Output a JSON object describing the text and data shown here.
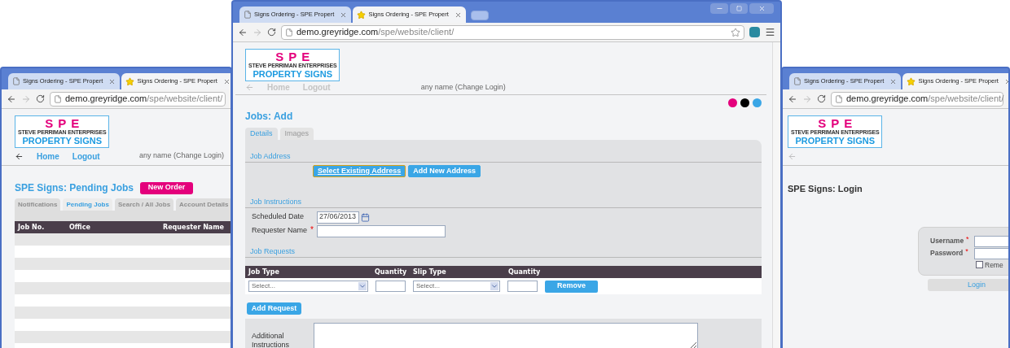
{
  "windows": [
    {
      "kind": "pending_jobs",
      "window_controls": false,
      "browser_tabs": [
        {
          "title": "Signs Ordering - SPE Propert",
          "selected": false
        },
        {
          "title": "Signs Ordering - SPE Propert",
          "selected": true
        }
      ],
      "address": {
        "host": "demo.greyridge.com",
        "path": "/spe/website/client/"
      },
      "logo": {
        "initials": "SPE",
        "tagline": "STEVE PERRIMAN ENTERPRISES",
        "name": "PROPERTY SIGNS"
      },
      "nav": [
        {
          "label": "Home",
          "disabled": false
        },
        {
          "label": "Logout",
          "disabled": false
        }
      ],
      "user": "any name (Change Login)",
      "heading": "SPE Signs: Pending Jobs",
      "new_order_button": "New Order",
      "page_tabs": [
        {
          "label": "Notifications",
          "selected": false
        },
        {
          "label": "Pending Jobs",
          "selected": true
        },
        {
          "label": "Search / All Jobs",
          "selected": false
        },
        {
          "label": "Account Details",
          "selected": false
        }
      ],
      "table": {
        "columns": [
          "Job No.",
          "Office",
          "Requester Name"
        ]
      }
    },
    {
      "kind": "add_job",
      "window_controls": true,
      "browser_tabs": [
        {
          "title": "Signs Ordering - SPE Propert",
          "selected": false
        },
        {
          "title": "Signs Ordering - SPE Propert",
          "selected": true
        }
      ],
      "address": {
        "host": "demo.greyridge.com",
        "path": "/spe/website/client/"
      },
      "logo": {
        "initials": "SPE",
        "tagline": "STEVE PERRIMAN ENTERPRISES",
        "name": "PROPERTY SIGNS"
      },
      "nav": [
        {
          "label": "Home",
          "disabled": true
        },
        {
          "label": "Logout",
          "disabled": true
        }
      ],
      "user": "any name (Change Login)",
      "swatches": [
        {
          "color": "#e4007c"
        },
        {
          "color": "#000000"
        },
        {
          "color": "#3aa6e6"
        }
      ],
      "heading": "Jobs: Add",
      "page_tabs": [
        {
          "label": "Details",
          "selected": true
        },
        {
          "label": "Images",
          "selected": false
        }
      ],
      "sections": [
        {
          "kind": "buttons",
          "title": "Job Address",
          "buttons": [
            {
              "label": "Select Existing Address",
              "focused": true
            },
            {
              "label": "Add New Address",
              "focused": false
            }
          ]
        },
        {
          "kind": "fields",
          "title": "Job Instructions",
          "fields": [
            {
              "kind": "date",
              "label": "Scheduled Date",
              "value": "27/06/2013"
            },
            {
              "kind": "text",
              "label": "Requester Name",
              "marker": "*"
            }
          ]
        },
        {
          "kind": "requests",
          "title": "Job Requests",
          "columns": [
            "Job Type",
            "Quantity",
            "Slip Type",
            "Quantity"
          ],
          "job_type": "Select...",
          "slip_type": "Select...",
          "remove_button": "Remove",
          "add_button": "Add Request"
        }
      ],
      "additional_instructions": {
        "label": "Additional Instructions"
      }
    },
    {
      "kind": "login",
      "window_controls": false,
      "browser_tabs": [
        {
          "title": "Signs Ordering - SPE Propert",
          "selected": false
        },
        {
          "title": "Signs Ordering - SPE Propert",
          "selected": true
        }
      ],
      "address": {
        "host": "demo.greyridge.com",
        "path": "/spe/website/client/"
      },
      "logo": {
        "initials": "SPE",
        "tagline": "STEVE PERRIMAN ENTERPRISES",
        "name": "PROPERTY SIGNS"
      },
      "heading": "SPE Signs: Login",
      "login": {
        "fields": [
          {
            "label": "Username",
            "marker": "*"
          },
          {
            "label": "Password",
            "marker": "*"
          }
        ],
        "remember": {
          "label": "Reme",
          "checked": false
        },
        "button": "Login"
      }
    }
  ]
}
